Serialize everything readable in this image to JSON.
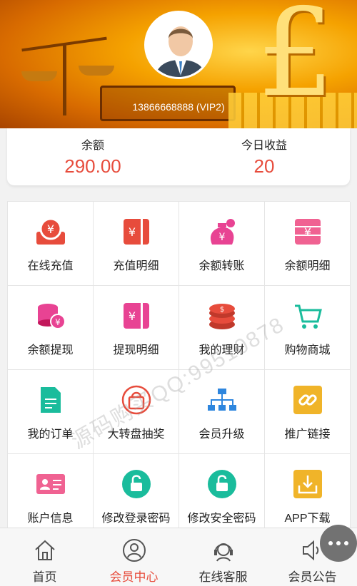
{
  "header": {
    "member_id": "13866668888 (VIP2)",
    "avatar_icon": "user-avatar-icon"
  },
  "balance": {
    "balance_label": "余额",
    "balance_value": "290.00",
    "today_label": "今日收益",
    "today_value": "20",
    "value_color": "#e74c3c"
  },
  "menu": [
    {
      "label": "在线充值",
      "icon": "recharge-icon"
    },
    {
      "label": "充值明细",
      "icon": "recharge-detail-icon"
    },
    {
      "label": "余额转账",
      "icon": "money-bag-transfer-icon"
    },
    {
      "label": "余额明细",
      "icon": "balance-detail-icon"
    },
    {
      "label": "余额提现",
      "icon": "coin-stack-withdraw-icon"
    },
    {
      "label": "提现明细",
      "icon": "withdraw-detail-icon"
    },
    {
      "label": "我的理财",
      "icon": "finance-coins-icon"
    },
    {
      "label": "购物商城",
      "icon": "shopping-cart-icon"
    },
    {
      "label": "我的订单",
      "icon": "document-icon"
    },
    {
      "label": "大转盘抽奖",
      "icon": "shopping-bag-icon"
    },
    {
      "label": "会员升级",
      "icon": "org-chart-icon"
    },
    {
      "label": "推广链接",
      "icon": "link-icon"
    },
    {
      "label": "账户信息",
      "icon": "id-card-icon"
    },
    {
      "label": "修改登录密码",
      "icon": "lock-icon"
    },
    {
      "label": "修改安全密码",
      "icon": "lock-icon"
    },
    {
      "label": "APP下载",
      "icon": "download-tray-icon"
    }
  ],
  "tabbar": [
    {
      "label": "首页",
      "icon": "home-icon",
      "active": false
    },
    {
      "label": "会员中心",
      "icon": "user-icon",
      "active": true
    },
    {
      "label": "在线客服",
      "icon": "headset-icon",
      "active": false
    },
    {
      "label": "会员公告",
      "icon": "speaker-icon",
      "active": false
    }
  ],
  "watermark": "源码购买QQ:99510878",
  "colors": {
    "accent": "#e74c3c"
  }
}
